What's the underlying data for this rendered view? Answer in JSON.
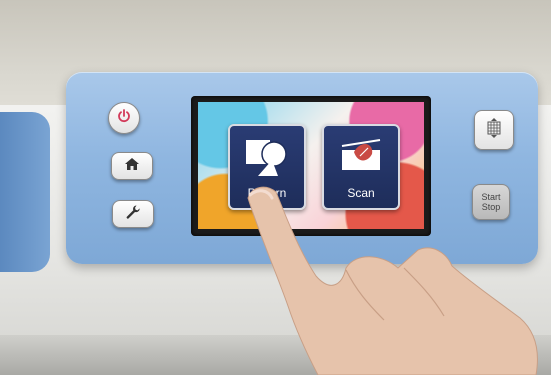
{
  "screen": {
    "tiles": [
      {
        "label": "Pattern"
      },
      {
        "label": "Scan"
      }
    ]
  },
  "hardware": {
    "start_stop_line1": "Start",
    "start_stop_line2": "Stop"
  },
  "icons": {
    "power": "power-icon",
    "home": "home-icon",
    "settings": "wrench-icon",
    "keypad": "keypad-icon"
  },
  "colors": {
    "panel": "#8fb6e0",
    "power_accent": "#d23a5a",
    "tile_bg": "#1e2d5a"
  }
}
